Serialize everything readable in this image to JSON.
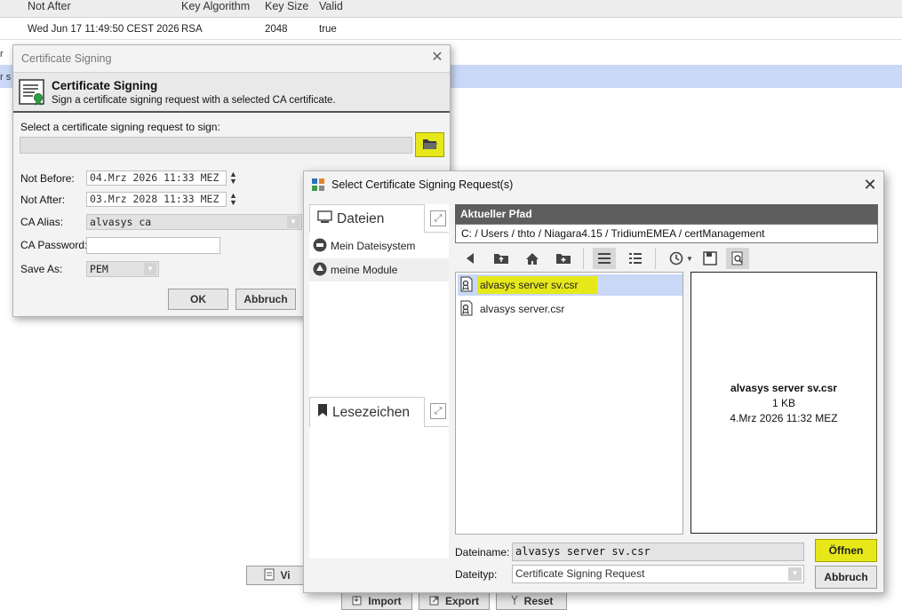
{
  "background_table": {
    "headers": [
      "Not After",
      "Key Algorithm",
      "Key Size",
      "Valid"
    ],
    "row": [
      "Wed Jun 17 11:49:50 CEST 2026",
      "RSA",
      "2048",
      "true"
    ],
    "left_fragments": [
      "r",
      "r s"
    ],
    "bottom_buttons": [
      "Vi",
      "Import",
      "Export",
      "Reset"
    ]
  },
  "cert_dialog": {
    "window_title": "Certificate Signing",
    "header_title": "Certificate Signing",
    "header_subtitle": "Sign a certificate signing request with a selected CA certificate.",
    "select_label": "Select a certificate signing request to sign:",
    "file_value": "",
    "not_before_label": "Not Before:",
    "not_before_value": "04.Mrz 2026 11:33 MEZ",
    "not_after_label": "Not After:",
    "not_after_value": "03.Mrz 2028 11:33 MEZ",
    "ca_alias_label": "CA Alias:",
    "ca_alias_value": "alvasys ca",
    "ca_password_label": "CA Password:",
    "ca_password_value": "",
    "save_as_label": "Save As:",
    "save_as_value": "PEM",
    "ok_label": "OK",
    "cancel_label": "Abbruch",
    "highlight_color": "#e6e81a"
  },
  "file_dialog": {
    "window_title": "Select Certificate Signing Request(s)",
    "files_tab": "Dateien",
    "nav_items": [
      "Mein Dateisystem",
      "meine Module"
    ],
    "bookmarks_tab": "Lesezeichen",
    "path_header": "Aktueller Pfad",
    "path_value": "C: / Users / thto / Niagara4.15 / TridiumEMEA / certManagement",
    "files": [
      {
        "name": "alvasys server sv.csr",
        "selected": true
      },
      {
        "name": "alvasys server.csr",
        "selected": false
      }
    ],
    "preview": {
      "name": "alvasys server sv.csr",
      "size": "1 KB",
      "date": "4.Mrz 2026 11:32 MEZ"
    },
    "filename_label": "Dateiname:",
    "filename_value": "alvasys server sv.csr",
    "filetype_label": "Dateityp:",
    "filetype_value": "Certificate Signing Request",
    "open_label": "Öffnen",
    "cancel_label": "Abbruch",
    "selection_color": "#c9d8f7"
  }
}
